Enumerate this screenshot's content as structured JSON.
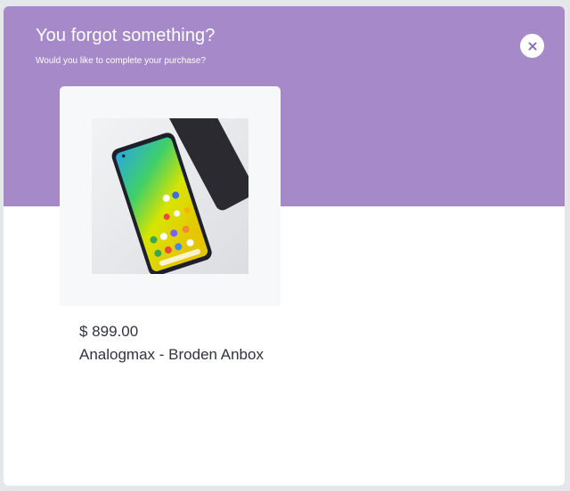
{
  "header": {
    "title": "You forgot something?",
    "subtitle": "Would you like to complete your purchase?",
    "close_icon": "close-icon",
    "background_color": "#a689c8"
  },
  "product": {
    "image": "smartphone-photo",
    "price": "$ 899.00",
    "name": "Analogmax - Broden Anbox"
  }
}
